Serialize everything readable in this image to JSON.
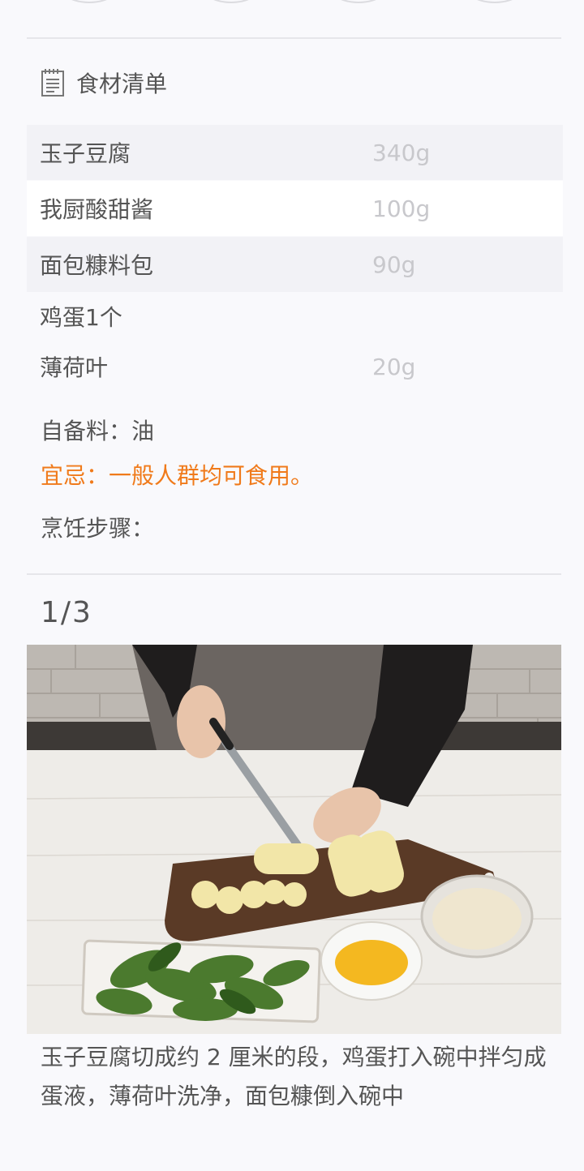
{
  "ingredients_section": {
    "title": "食材清单",
    "items": [
      {
        "name": "玉子豆腐",
        "amount": "340g"
      },
      {
        "name": "我厨酸甜酱",
        "amount": "100g"
      },
      {
        "name": "面包糠料包",
        "amount": "90g"
      },
      {
        "name": "鸡蛋1个",
        "amount": ""
      },
      {
        "name": "薄荷叶",
        "amount": "20g"
      }
    ]
  },
  "notes": {
    "self_prepared": "自备料：油",
    "taboo": "宜忌：一般人群均可食用。",
    "steps_heading": "烹饪步骤："
  },
  "step": {
    "number": "1/3",
    "description": "玉子豆腐切成约 2 厘米的段，鸡蛋打入碗中拌匀成蛋液，薄荷叶洗净，面包糠倒入碗中"
  },
  "colors": {
    "accent": "#f07a1a",
    "text": "#555555",
    "muted": "#c8c8cc",
    "row_shade": "#f2f2f6"
  }
}
